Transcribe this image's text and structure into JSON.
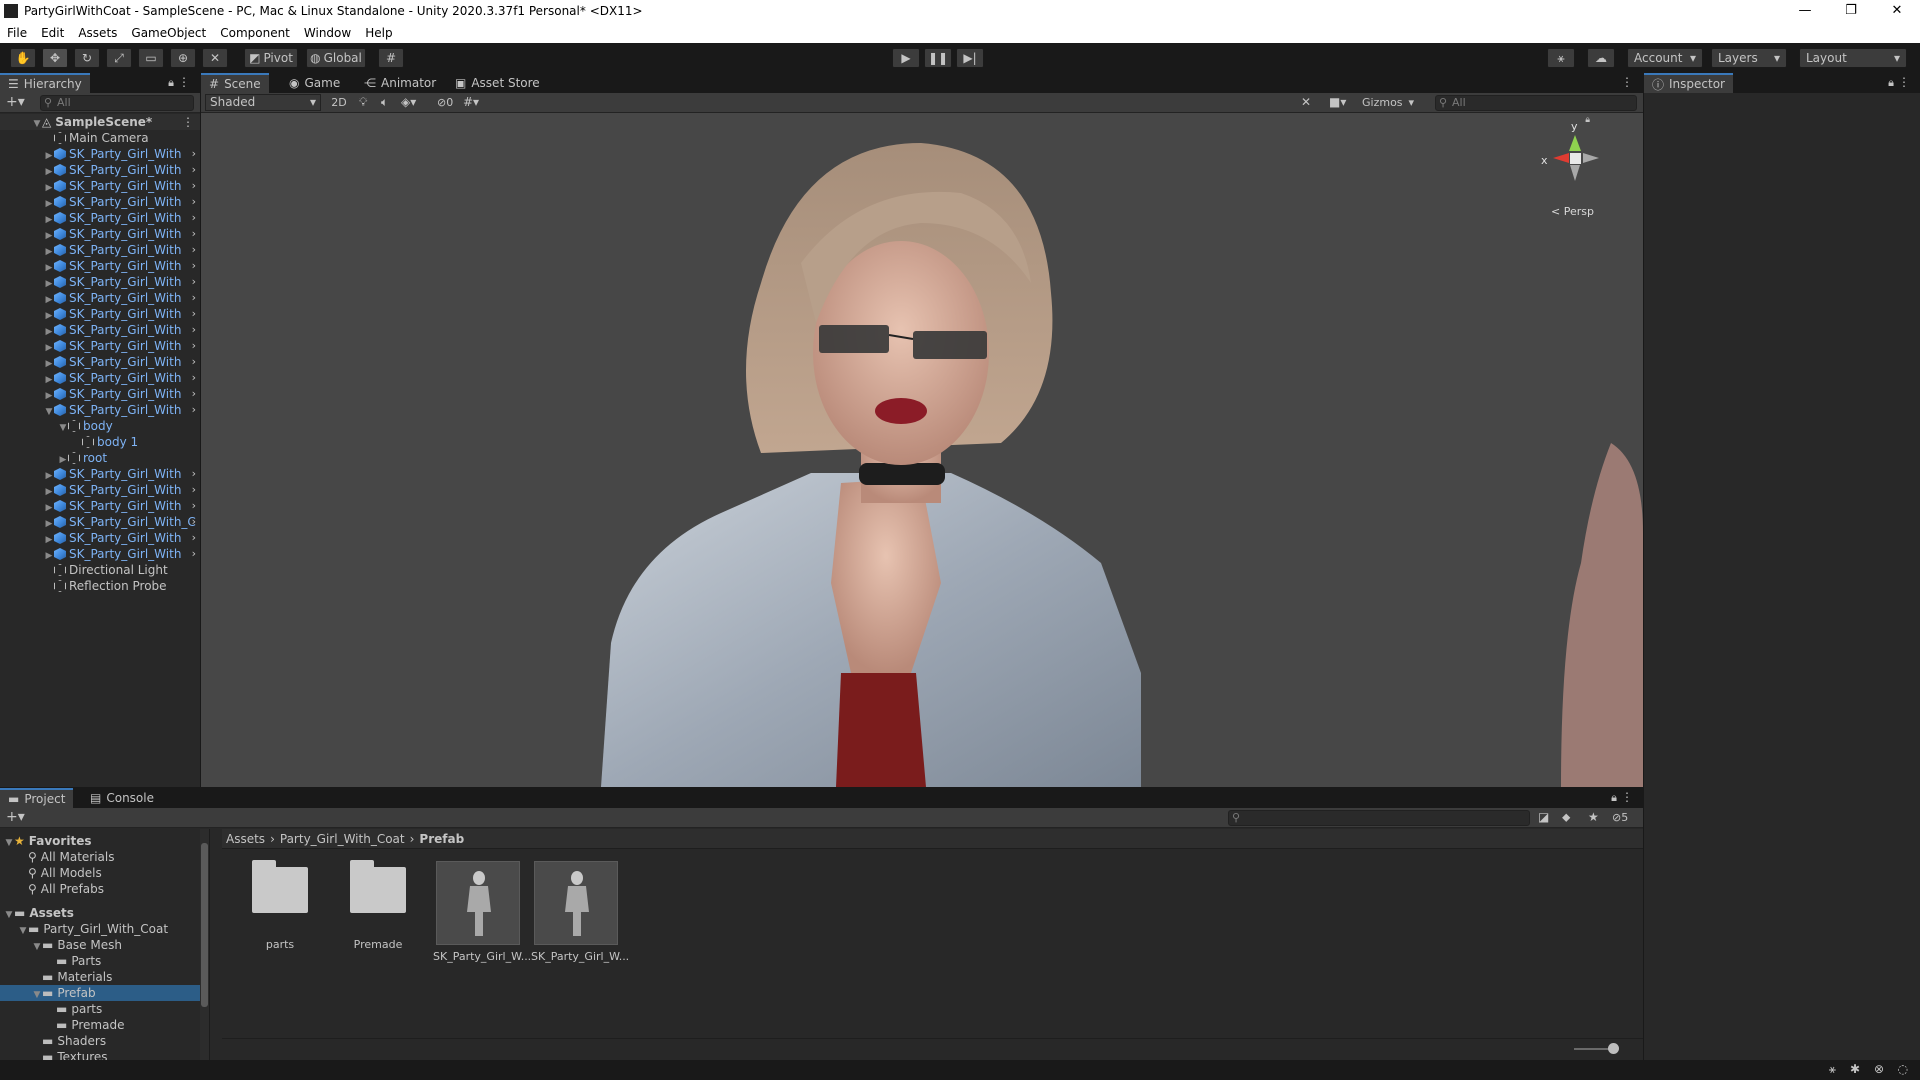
{
  "window": {
    "title": "PartyGirlWithCoat - SampleScene - PC, Mac & Linux Standalone - Unity 2020.3.37f1 Personal* <DX11>",
    "controls": [
      "—",
      "❐",
      "✕"
    ]
  },
  "menu": [
    "File",
    "Edit",
    "Assets",
    "GameObject",
    "Component",
    "Window",
    "Help"
  ],
  "toolbar": {
    "pivot": "Pivot",
    "global": "Global",
    "account": "Account",
    "layers": "Layers",
    "layout": "Layout"
  },
  "hierarchy": {
    "tab": "Hierarchy",
    "search_placeholder": "All",
    "scene": "SampleScene*",
    "items": [
      {
        "label": "Main Camera",
        "type": "object",
        "indent": 1
      },
      {
        "label": "SK_Party_Girl_With",
        "type": "prefab",
        "indent": 1
      },
      {
        "label": "SK_Party_Girl_With",
        "type": "prefab",
        "indent": 1
      },
      {
        "label": "SK_Party_Girl_With",
        "type": "prefab",
        "indent": 1
      },
      {
        "label": "SK_Party_Girl_With",
        "type": "prefab",
        "indent": 1
      },
      {
        "label": "SK_Party_Girl_With",
        "type": "prefab",
        "indent": 1
      },
      {
        "label": "SK_Party_Girl_With",
        "type": "prefab",
        "indent": 1
      },
      {
        "label": "SK_Party_Girl_With",
        "type": "prefab",
        "indent": 1
      },
      {
        "label": "SK_Party_Girl_With",
        "type": "prefab",
        "indent": 1
      },
      {
        "label": "SK_Party_Girl_With",
        "type": "prefab",
        "indent": 1
      },
      {
        "label": "SK_Party_Girl_With",
        "type": "prefab",
        "indent": 1
      },
      {
        "label": "SK_Party_Girl_With",
        "type": "prefab",
        "indent": 1
      },
      {
        "label": "SK_Party_Girl_With",
        "type": "prefab",
        "indent": 1
      },
      {
        "label": "SK_Party_Girl_With",
        "type": "prefab",
        "indent": 1
      },
      {
        "label": "SK_Party_Girl_With",
        "type": "prefab",
        "indent": 1
      },
      {
        "label": "SK_Party_Girl_With",
        "type": "prefab",
        "indent": 1
      },
      {
        "label": "SK_Party_Girl_With",
        "type": "prefab",
        "indent": 1
      },
      {
        "label": "SK_Party_Girl_With",
        "type": "prefab",
        "indent": 1,
        "expanded": true
      },
      {
        "label": "body",
        "type": "child",
        "indent": 2,
        "expanded": true
      },
      {
        "label": "body 1",
        "type": "child",
        "indent": 3
      },
      {
        "label": "root",
        "type": "child",
        "indent": 2
      },
      {
        "label": "SK_Party_Girl_With",
        "type": "prefab",
        "indent": 1
      },
      {
        "label": "SK_Party_Girl_With",
        "type": "prefab",
        "indent": 1
      },
      {
        "label": "SK_Party_Girl_With",
        "type": "prefab",
        "indent": 1
      },
      {
        "label": "SK_Party_Girl_With_C",
        "type": "prefab",
        "indent": 1
      },
      {
        "label": "SK_Party_Girl_With",
        "type": "prefab",
        "indent": 1
      },
      {
        "label": "SK_Party_Girl_With",
        "type": "prefab",
        "indent": 1
      },
      {
        "label": "Directional Light",
        "type": "object",
        "indent": 1
      },
      {
        "label": "Reflection Probe",
        "type": "object",
        "indent": 1
      }
    ]
  },
  "scene_tabs": [
    "Scene",
    "Game",
    "Animator",
    "Asset Store"
  ],
  "scene_toolbar": {
    "shading": "Shaded",
    "mode_2d": "2D",
    "hidden_count": "0",
    "gizmos": "Gizmos",
    "search_placeholder": "All"
  },
  "gizmo": {
    "y": "y",
    "x": "x",
    "persp": "< Persp"
  },
  "inspector": {
    "tab": "Inspector"
  },
  "project": {
    "tabs": [
      "Project",
      "Console"
    ],
    "tree": [
      {
        "label": "Favorites",
        "indent": 0,
        "bold": true
      },
      {
        "label": "All Materials",
        "indent": 1
      },
      {
        "label": "All Models",
        "indent": 1
      },
      {
        "label": "All Prefabs",
        "indent": 1
      },
      {
        "label": "Assets",
        "indent": 0,
        "bold": true
      },
      {
        "label": "Party_Girl_With_Coat",
        "indent": 1
      },
      {
        "label": "Base Mesh",
        "indent": 2
      },
      {
        "label": "Parts",
        "indent": 3
      },
      {
        "label": "Materials",
        "indent": 2
      },
      {
        "label": "Prefab",
        "indent": 2,
        "selected": true
      },
      {
        "label": "parts",
        "indent": 3
      },
      {
        "label": "Premade",
        "indent": 3
      },
      {
        "label": "Shaders",
        "indent": 2
      },
      {
        "label": "Textures",
        "indent": 2
      }
    ],
    "breadcrumb": [
      "Assets",
      "Party_Girl_With_Coat",
      "Prefab"
    ],
    "hidden_count": "5",
    "assets": [
      {
        "label": "parts",
        "type": "folder"
      },
      {
        "label": "Premade",
        "type": "folder"
      },
      {
        "label": "SK_Party_Girl_W...",
        "type": "prefab"
      },
      {
        "label": "SK_Party_Girl_W...",
        "type": "prefab"
      }
    ]
  },
  "colors": {
    "accent": "#3a79bb",
    "prefab_text": "#7eb3f5",
    "selection": "#2c5d87",
    "scene_bg": "#474747"
  }
}
